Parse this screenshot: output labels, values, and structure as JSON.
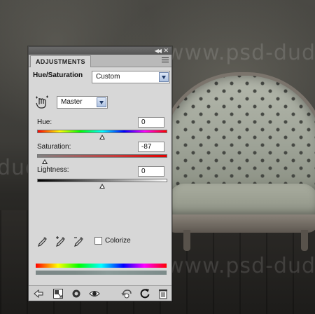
{
  "background": {
    "watermark_text": "www.psd-dude.com",
    "watermark_fragments": [
      "www",
      "psd-dude",
      "dude.com",
      "www.psd-dude"
    ]
  },
  "panel": {
    "tab_label": "ADJUSTMENTS",
    "collapse_icon": "double-chevron-left-icon",
    "close_icon": "close-icon",
    "menu_icon": "panel-menu-icon",
    "preset_label": "Hue/Saturation",
    "preset_value": "Custom",
    "channel_value": "Master",
    "hue_label": "Hue:",
    "hue_value": "0",
    "saturation_label": "Saturation:",
    "saturation_value": "-87",
    "lightness_label": "Lightness:",
    "lightness_value": "0",
    "colorize_label": "Colorize",
    "colorize_checked": false,
    "colors": {
      "panel_bg": "#d7d7d7",
      "tab_bar": "#b9b9b9",
      "top_bar": "#5e5e5e",
      "dropdown_arrow": "#aec2e1"
    }
  },
  "bottom_toolbar": {
    "icons": [
      "back-arrow-icon",
      "expanded-view-icon",
      "clip-to-layer-icon",
      "visibility-eye-icon",
      "view-previous-state-icon",
      "reset-icon",
      "trash-icon"
    ]
  }
}
